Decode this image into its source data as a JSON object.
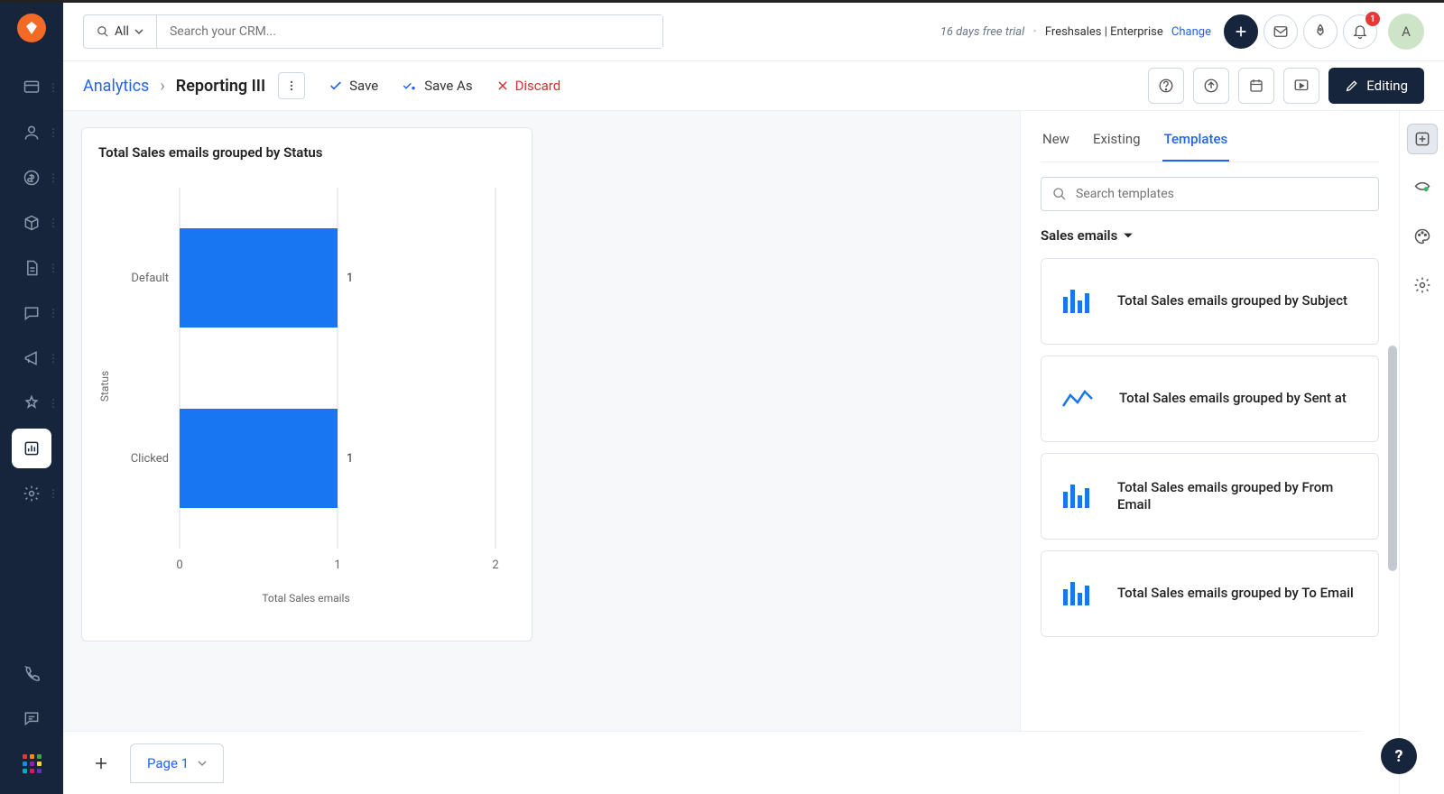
{
  "header": {
    "search_scope": "All",
    "search_placeholder": "Search your CRM...",
    "trial_days": "16 days free trial",
    "product": "Freshsales | Enterprise",
    "change_label": "Change",
    "notif_count": "1",
    "avatar_letter": "A"
  },
  "actionbar": {
    "root": "Analytics",
    "current": "Reporting III",
    "save": "Save",
    "save_as": "Save As",
    "discard": "Discard",
    "editing": "Editing"
  },
  "chart_data": {
    "type": "bar",
    "orientation": "horizontal",
    "title": "Total Sales emails grouped by Status",
    "xlabel": "Total Sales emails",
    "ylabel": "Status",
    "xlim": [
      0,
      2
    ],
    "xticks": [
      0,
      1,
      2
    ],
    "categories": [
      "Default",
      "Clicked"
    ],
    "values": [
      1,
      1
    ],
    "bar_color": "#1976f2"
  },
  "right_panel": {
    "tabs": [
      "New",
      "Existing",
      "Templates"
    ],
    "active_tab": "Templates",
    "search_placeholder": "Search templates",
    "group": "Sales emails",
    "templates": [
      {
        "icon": "bar",
        "label": "Total Sales emails grouped by Subject"
      },
      {
        "icon": "line",
        "label": "Total Sales emails grouped by Sent at"
      },
      {
        "icon": "bar",
        "label": "Total Sales emails grouped by From Email"
      },
      {
        "icon": "bar",
        "label": "Total Sales emails grouped by To Email"
      }
    ]
  },
  "pagebar": {
    "page_label": "Page 1"
  }
}
